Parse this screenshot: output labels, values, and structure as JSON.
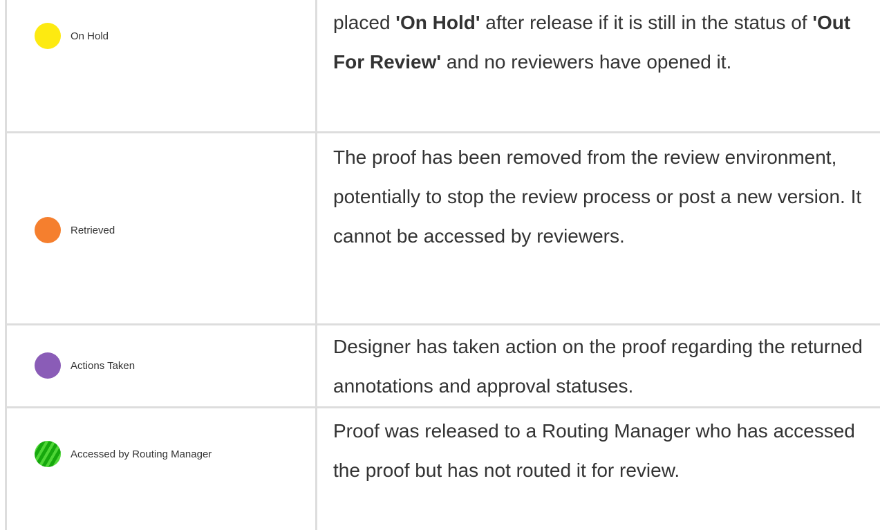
{
  "colors": {
    "border": "#dddddd",
    "text": "#333333",
    "on_hold": "#fdea11",
    "retrieved": "#f57f2e",
    "actions_taken": "#8a5cb7",
    "accessed_stripe_dark": "#16a80d",
    "accessed_stripe_light": "#4ed636"
  },
  "rows": [
    {
      "status": {
        "label": "On Hold",
        "icon": "yellow-circle-icon"
      },
      "description": {
        "p1": "placed ",
        "b1": "'On Hold'",
        "p2": " after release if it is still in the status of ",
        "b2": "'Out For Review'",
        "p3": " and no reviewers have opened it."
      }
    },
    {
      "status": {
        "label": "Retrieved",
        "icon": "orange-circle-icon"
      },
      "description": {
        "text": "The proof has been removed from the review environment, potentially to stop the review process or post a new version. It cannot be accessed by reviewers."
      }
    },
    {
      "status": {
        "label": "Actions Taken",
        "icon": "purple-circle-icon"
      },
      "description": {
        "text": "Designer has taken action on the proof regarding the returned annotations and approval statuses."
      }
    },
    {
      "status": {
        "label": "Accessed by Routing Manager",
        "icon": "green-striped-circle-icon"
      },
      "description": {
        "text": "Proof was released to a Routing Manager who has accessed the proof but has not routed it for review."
      }
    }
  ]
}
